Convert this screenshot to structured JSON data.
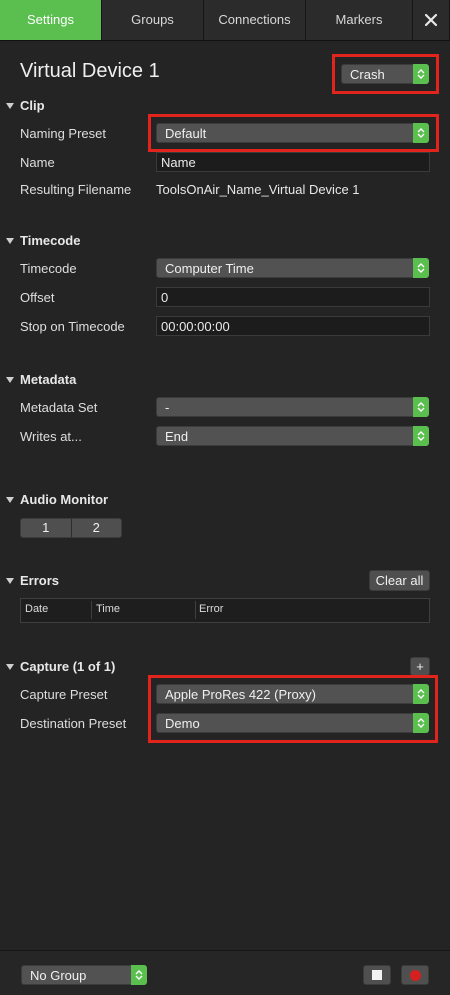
{
  "tabs": [
    "Settings",
    "Groups",
    "Connections",
    "Markers"
  ],
  "device": {
    "title": "Virtual Device 1",
    "mode": "Crash"
  },
  "clip": {
    "heading": "Clip",
    "naming_preset_label": "Naming Preset",
    "naming_preset": "Default",
    "name_label": "Name",
    "name_value": "Name",
    "filename_label": "Resulting Filename",
    "filename_value": "ToolsOnAir_Name_Virtual Device 1"
  },
  "timecode": {
    "heading": "Timecode",
    "timecode_label": "Timecode",
    "timecode_value": "Computer Time",
    "offset_label": "Offset",
    "offset_value": "0",
    "stop_label": "Stop on Timecode",
    "stop_value": "00:00:00:00"
  },
  "metadata": {
    "heading": "Metadata",
    "set_label": "Metadata Set",
    "set_value": "-",
    "writes_label": "Writes at...",
    "writes_value": "End"
  },
  "audio": {
    "heading": "Audio Monitor",
    "channels": [
      "1",
      "2"
    ]
  },
  "errors": {
    "heading": "Errors",
    "clear_label": "Clear all",
    "columns": [
      "Date",
      "Time",
      "Error"
    ]
  },
  "capture": {
    "heading": "Capture (1 of 1)",
    "add_label": "+",
    "preset_label": "Capture Preset",
    "preset_value": "Apple ProRes 422 (Proxy)",
    "dest_label": "Destination Preset",
    "dest_value": "Demo"
  },
  "footer": {
    "group": "No Group"
  },
  "colors": {
    "accent": "#5bbf4f",
    "highlight": "#e2251c",
    "record": "#d62020"
  }
}
